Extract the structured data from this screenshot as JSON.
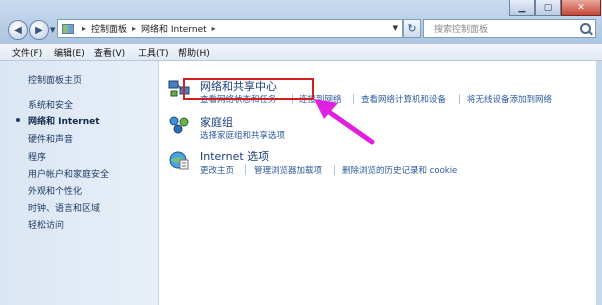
{
  "address_bar": {
    "segments": [
      "控制面板",
      "网络和 Internet"
    ],
    "search_placeholder": "搜索控制面板"
  },
  "menubar": {
    "items": [
      "文件(F)",
      "编辑(E)",
      "查看(V)",
      "工具(T)",
      "帮助(H)"
    ]
  },
  "sidebar": {
    "items": [
      {
        "label": "控制面板主页"
      },
      {
        "label": "系统和安全"
      },
      {
        "label": "网络和 Internet",
        "active": true
      },
      {
        "label": "硬件和声音"
      },
      {
        "label": "程序"
      },
      {
        "label": "用户帐户和家庭安全"
      },
      {
        "label": "外观和个性化"
      },
      {
        "label": "时钟、语言和区域"
      },
      {
        "label": "轻松访问"
      }
    ]
  },
  "categories": [
    {
      "title": "网络和共享中心",
      "icon": "network-center-icon",
      "links": [
        "查看网络状态和任务",
        "连接到网络",
        "查看网络计算机和设备",
        "将无线设备添加到网络"
      ]
    },
    {
      "title": "家庭组",
      "icon": "homegroup-icon",
      "links": [
        "选择家庭组和共享选项"
      ]
    },
    {
      "title": "Internet 选项",
      "icon": "internet-options-icon",
      "links": [
        "更改主页",
        "管理浏览器加载项",
        "删除浏览的历史记录和 cookie"
      ]
    }
  ],
  "colors": {
    "highlight": "#d02020",
    "arrow": "#e020e0",
    "link": "#2b5a9e",
    "title": "#1a3f7a"
  }
}
